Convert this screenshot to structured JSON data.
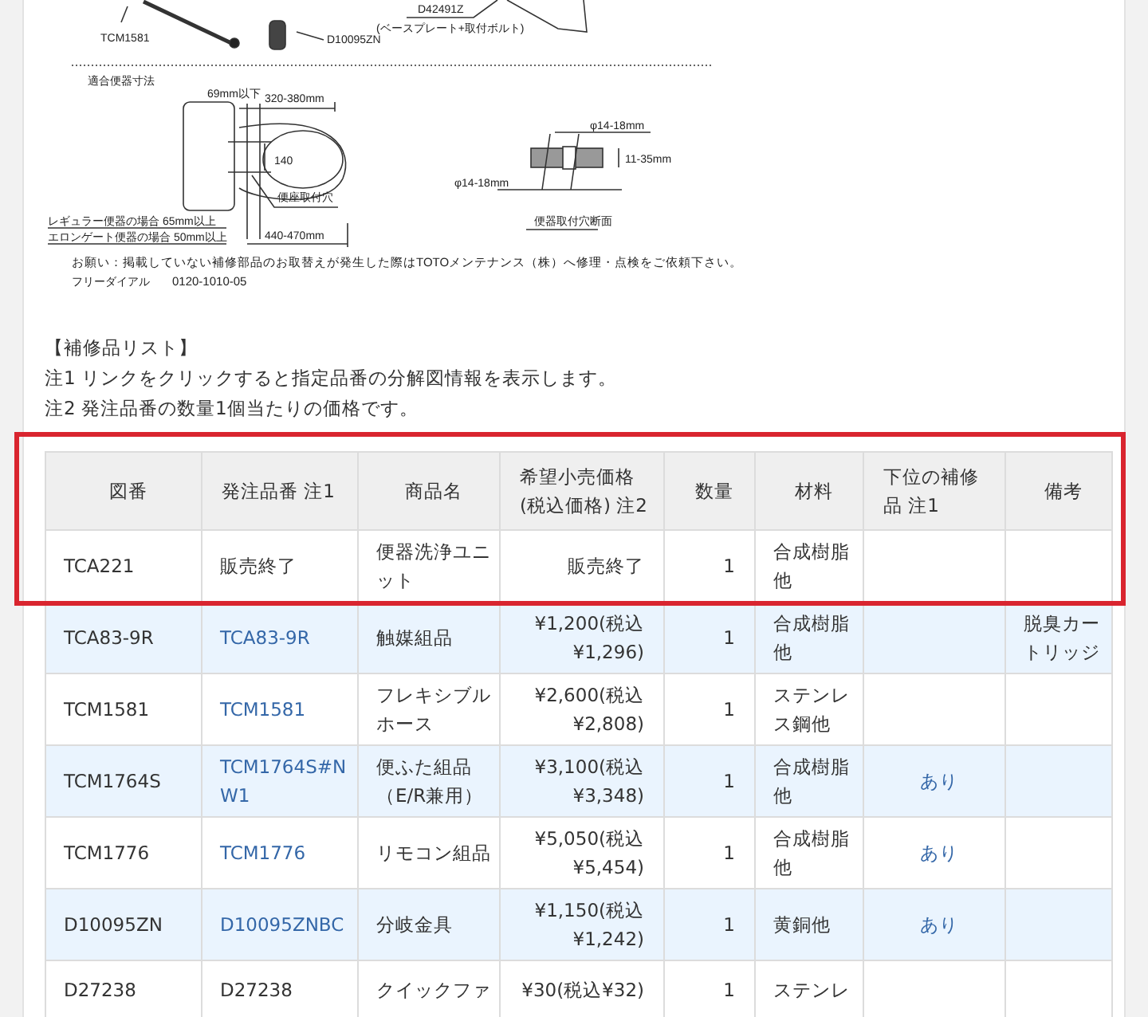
{
  "diagram": {
    "labels": [
      {
        "text": "TCM1581"
      },
      {
        "text": "D10095ZN"
      },
      {
        "text": "D42491Z"
      },
      {
        "text": "(ベースプレート+取付ボルト)"
      },
      {
        "text": "適合便器寸法"
      },
      {
        "text": "69mm以下"
      },
      {
        "text": "320-380mm"
      },
      {
        "text": "140"
      },
      {
        "text": "便座取付穴"
      },
      {
        "text": "レギュラー便器の場合 65mm以上"
      },
      {
        "text": "エロンゲート便器の場合 50mm以上"
      },
      {
        "text": "440-470mm"
      },
      {
        "text": "φ14-18mm"
      },
      {
        "text": "11-35mm"
      },
      {
        "text": "φ14-18mm"
      },
      {
        "text": "便器取付穴断面"
      },
      {
        "text": "お願い：掲載していない補修部品のお取替えが発生した際はTOTOメンテナンス（株）へ修理・点検をご依頼下さい。"
      },
      {
        "text": "フリーダイアル"
      },
      {
        "text": "0120-1010-05"
      }
    ]
  },
  "notes": [
    "【補修品リスト】",
    "注1 リンクをクリックすると指定品番の分解図情報を表示します。",
    "注2 発注品番の数量1個当たりの価格です。"
  ],
  "table": {
    "columns": [
      "図番",
      "発注品番 注1",
      "商品名",
      "希望小売価格 (税込価格) 注2",
      "数量",
      "材料",
      "下位の補修品 注1",
      "備考"
    ],
    "highlighted_rows": [
      {
        "figure": "TCA221",
        "order": {
          "text": "販売終了",
          "link": false
        },
        "name": "便器洗浄ユニット",
        "price": "販売終了",
        "qty": "1",
        "material": "合成樹脂他",
        "sub": null,
        "note": ""
      }
    ],
    "rows": [
      {
        "figure": "TCA83-9R",
        "order": {
          "text": "TCA83-9R",
          "link": true
        },
        "name": "触媒組品",
        "price": "¥1,200(税込¥1,296)",
        "qty": "1",
        "material": "合成樹脂他",
        "sub": null,
        "note": "脱臭カートリッジ"
      },
      {
        "figure": "TCM1581",
        "order": {
          "text": "TCM1581",
          "link": true
        },
        "name": "フレキシブルホース",
        "price": "¥2,600(税込¥2,808)",
        "qty": "1",
        "material": "ステンレス鋼他",
        "sub": null,
        "note": ""
      },
      {
        "figure": "TCM1764S",
        "order": {
          "text": "TCM1764S#NW1",
          "link": true
        },
        "name": "便ふた組品（E/R兼用）",
        "price": "¥3,100(税込¥3,348)",
        "qty": "1",
        "material": "合成樹脂他",
        "sub": "あり",
        "note": ""
      },
      {
        "figure": "TCM1776",
        "order": {
          "text": "TCM1776",
          "link": true
        },
        "name": "リモコン組品",
        "price": "¥5,050(税込¥5,454)",
        "qty": "1",
        "material": "合成樹脂他",
        "sub": "あり",
        "note": ""
      },
      {
        "figure": "D10095ZN",
        "order": {
          "text": "D10095ZNBC",
          "link": true
        },
        "name": "分岐金具",
        "price": "¥1,150(税込¥1,242)",
        "qty": "1",
        "material": "黄銅他",
        "sub": "あり",
        "note": ""
      },
      {
        "figure": "D27238",
        "order": {
          "text": "D27238",
          "link": false
        },
        "name": "クイックファ",
        "price": "¥30(税込¥32)",
        "qty": "1",
        "material": "ステンレ",
        "sub": null,
        "note": ""
      }
    ]
  }
}
